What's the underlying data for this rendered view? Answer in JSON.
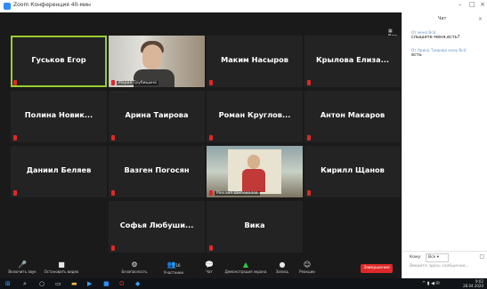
{
  "window": {
    "title": "Zoom Конференция 40-мин"
  },
  "view_button": "Вид",
  "tiles": [
    {
      "name": "Гуськов Егор",
      "active": true
    },
    {
      "name": "",
      "subname": "Мария Трубицына",
      "video": "person"
    },
    {
      "name": "Маким Насыров"
    },
    {
      "name": "Крылова Елиза..."
    },
    {
      "name": "Полина Новик..."
    },
    {
      "name": "Арина Таирова"
    },
    {
      "name": "Роман Круглов..."
    },
    {
      "name": "Антон Макаров"
    },
    {
      "name": "Даниил Беляев"
    },
    {
      "name": "Вазген Погосян"
    },
    {
      "name": "",
      "subname": "Михаил Шиповалов",
      "video": "child"
    },
    {
      "name": "Кирилл Щанов"
    },
    {
      "name": "Софья Любуши..."
    },
    {
      "name": "Вика"
    }
  ],
  "toolbar": {
    "buttons": [
      {
        "icon": "microphone-icon",
        "glyph": "🎤",
        "label": "Включить звук"
      },
      {
        "icon": "video-camera-icon",
        "glyph": "■",
        "label": "Остановить видео"
      },
      {
        "icon": "security-icon",
        "glyph": "⚙",
        "label": "Безопасность"
      },
      {
        "icon": "participants-icon",
        "glyph": "👥",
        "label": "Участники",
        "count": "16"
      },
      {
        "icon": "chat-icon",
        "glyph": "💬",
        "label": "Чат"
      },
      {
        "icon": "share-screen-icon",
        "glyph": "▲",
        "label": "Демонстрация экрана",
        "highlight": true
      },
      {
        "icon": "record-icon",
        "glyph": "●",
        "label": "Запись"
      },
      {
        "icon": "reactions-icon",
        "glyph": "☺",
        "label": "Реакции"
      }
    ],
    "end_label": "Завершение"
  },
  "chat": {
    "header": "Чат",
    "messages": [
      {
        "from": "От меня Всё:",
        "text": "слышите меня,есть?"
      },
      {
        "from": "От Арина Таирова кому Всё:",
        "text": "есть"
      }
    ],
    "to_label": "Кому:",
    "to_value": "Все",
    "input_placeholder": "Введите здесь сообщение..."
  },
  "taskbar": {
    "time": "9:02",
    "date": "28.04.2020"
  },
  "colors": {
    "active_outline": "#9acd32",
    "mic_muted": "#e02828",
    "end_button": "#e02828",
    "share_green": "#2ecc40"
  }
}
